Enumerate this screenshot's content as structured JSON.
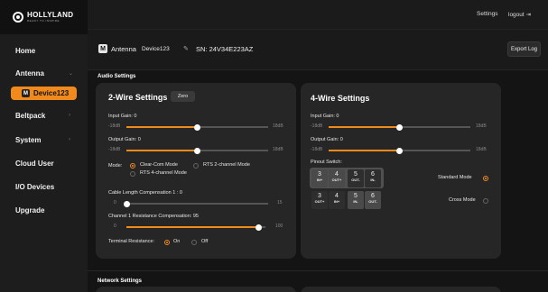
{
  "brand": {
    "name": "HOLLYLAND",
    "tagline": "READY TO INSPIRE"
  },
  "sidebar": {
    "items": [
      {
        "label": "Home",
        "chevron": false
      },
      {
        "label": "Antenna",
        "chevron": true
      },
      {
        "label": "Beltpack",
        "chevron": true
      },
      {
        "label": "System",
        "chevron": true
      },
      {
        "label": "Cloud User",
        "chevron": false
      },
      {
        "label": "I/O Devices",
        "chevron": false
      },
      {
        "label": "Upgrade",
        "chevron": false
      }
    ],
    "active_device": "Device123"
  },
  "topbar": {
    "settings": "Settings",
    "logout": "logout"
  },
  "device": {
    "type": "Antenna",
    "name": "Device123",
    "sn": "SN: 24V34E223AZ",
    "export": "Export Log"
  },
  "audio": {
    "title": "Audio Settings",
    "two_wire": {
      "title": "2-Wire Settings",
      "zero": "Zero",
      "input_gain": {
        "label": "Input Gain: 0",
        "min": "-18dB",
        "max": "18dB",
        "value": 0
      },
      "output_gain": {
        "label": "Output Gain: 0",
        "min": "-18dB",
        "max": "18dB",
        "value": 0
      },
      "mode_label": "Mode:",
      "modes": [
        "Clear-Com Mode",
        "RTS 2-channel Mode",
        "RTS 4-channel Mode"
      ],
      "mode_selected": 0,
      "cable": {
        "label": "Cable Length Compensation 1 :  0",
        "min": "0",
        "max": "15",
        "value": 0
      },
      "resistance": {
        "label": "Channel 1 Resistance Compensation:  95",
        "min": "0",
        "max": "100",
        "value": 95
      },
      "terminal_label": "Terminal Resistance:",
      "terminal_on": "On",
      "terminal_off": "Off",
      "terminal_selected": "On"
    },
    "four_wire": {
      "title": "4-Wire Settings",
      "input_gain": {
        "label": "Input Gain: 0",
        "min": "-18dB",
        "max": "18dB",
        "value": 0
      },
      "output_gain": {
        "label": "Output Gain: 0",
        "min": "-18dB",
        "max": "18dB",
        "value": 0
      },
      "pinout_label": "Pinout Switch:",
      "standard": {
        "label": "Standard Mode",
        "pins": [
          {
            "n": "3",
            "t": "IN+"
          },
          {
            "n": "4",
            "t": "OUT+"
          },
          {
            "n": "5",
            "t": "OUT-"
          },
          {
            "n": "6",
            "t": "IN-"
          }
        ]
      },
      "cross": {
        "label": "Cross Mode",
        "pins": [
          {
            "n": "3",
            "t": "OUT+"
          },
          {
            "n": "4",
            "t": "IN+"
          },
          {
            "n": "5",
            "t": "IN-"
          },
          {
            "n": "6",
            "t": "OUT-"
          }
        ]
      },
      "selected": "Standard Mode"
    }
  },
  "network": {
    "title": "Network Settings"
  },
  "colors": {
    "accent": "#f08a1c",
    "bg": "#141414",
    "card": "#262626"
  }
}
